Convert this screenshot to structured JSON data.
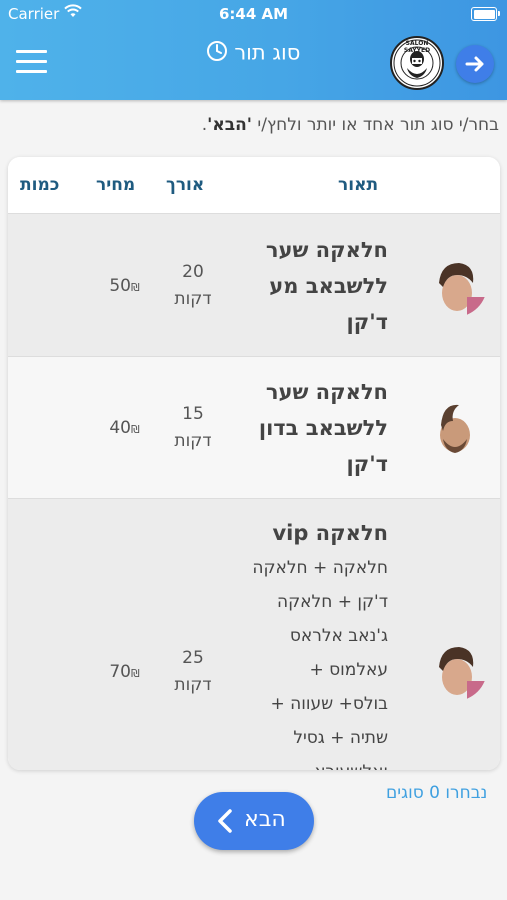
{
  "status_bar": {
    "carrier": "Carrier",
    "time": "6:44 AM"
  },
  "header": {
    "title": "סוג תור",
    "logo_text": "SALON SAYYED"
  },
  "instruction": {
    "text": "בחר/י סוג תור אחד או יותר ולחץ/י ",
    "emphasis": "'הבא'",
    "end": "."
  },
  "table": {
    "columns": {
      "description": "תאור",
      "duration": "אורך",
      "price": "מחיר",
      "quantity": "כמות"
    },
    "rows": [
      {
        "title_lines": [
          "חלאקה שער",
          "ללשבאב מע",
          "ד'קן"
        ],
        "details": [],
        "duration_num": "20",
        "duration_unit": "דקות",
        "price": "50",
        "currency": "₪"
      },
      {
        "title_lines": [
          "חלאקה שער",
          "ללשבאב בדון",
          "ד'קן"
        ],
        "details": [],
        "duration_num": "15",
        "duration_unit": "דקות",
        "price": "40",
        "currency": "₪"
      },
      {
        "title_lines": [
          "חלאקה vip"
        ],
        "details": [
          "חלאקה + חלאקה",
          "ד'קן + חלאקה",
          "ג'נאב אלראס",
          "עאלמוס +",
          "בולס+ שעווה +",
          "שתיה + גסיל",
          "ואלשעורא"
        ],
        "duration_num": "25",
        "duration_unit": "דקות",
        "price": "70",
        "currency": "₪"
      }
    ]
  },
  "footer": {
    "selected_text": "נבחרו 0 סוגים",
    "next_label": "הבא"
  },
  "colors": {
    "header_blue": "#46a6e6",
    "button_blue": "#3f7ee8",
    "heading_color": "#1f5b80",
    "selected_text": "#3fa0e0"
  },
  "icons": [
    "wifi-icon",
    "battery-icon",
    "hamburger-menu-icon",
    "clock-icon",
    "salon-logo",
    "arrow-right-icon",
    "chevron-left-icon"
  ]
}
